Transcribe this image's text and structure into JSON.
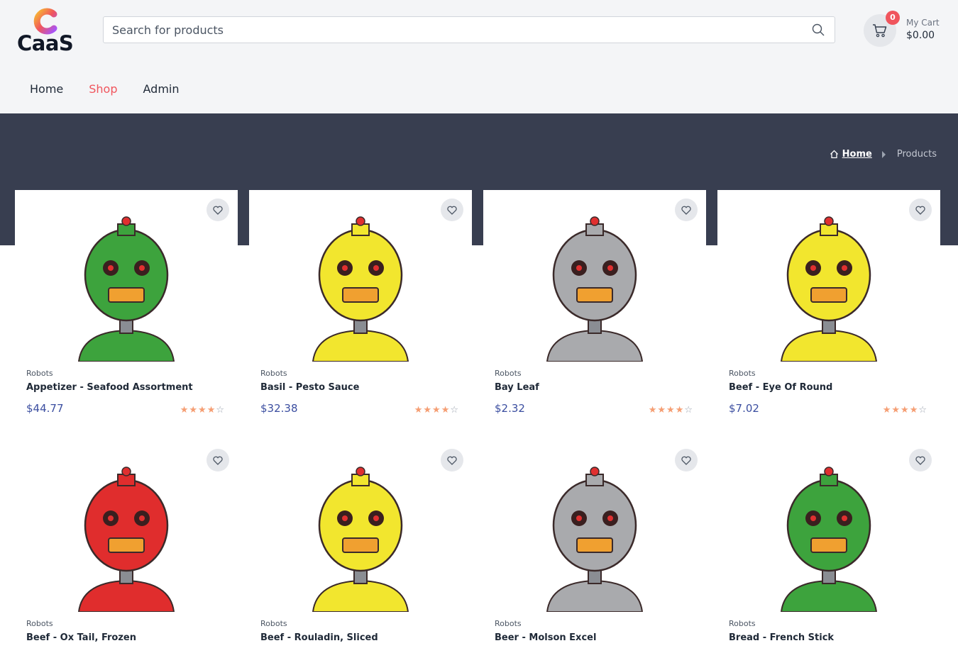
{
  "brand": {
    "name": "CaaS",
    "accent": "#f0555d"
  },
  "search": {
    "placeholder": "Search for products"
  },
  "cart": {
    "count": "0",
    "label": "My Cart",
    "total": "$0.00"
  },
  "nav": [
    {
      "label": "Home",
      "active": false
    },
    {
      "label": "Shop",
      "active": true
    },
    {
      "label": "Admin",
      "active": false
    }
  ],
  "breadcrumb": {
    "home": "Home",
    "current": "Products"
  },
  "products": [
    {
      "category": "Robots",
      "title": "Appetizer - Seafood Assortment",
      "price": "$44.77",
      "rating": 4,
      "color": "#3da33d"
    },
    {
      "category": "Robots",
      "title": "Basil - Pesto Sauce",
      "price": "$32.38",
      "rating": 4,
      "color": "#f2e62e"
    },
    {
      "category": "Robots",
      "title": "Bay Leaf",
      "price": "$2.32",
      "rating": 4,
      "color": "#a9aaad"
    },
    {
      "category": "Robots",
      "title": "Beef - Eye Of Round",
      "price": "$7.02",
      "rating": 4,
      "color": "#f2e62e"
    },
    {
      "category": "Robots",
      "title": "Beef - Ox Tail, Frozen",
      "price": "",
      "rating": 0,
      "color": "#e02d2d"
    },
    {
      "category": "Robots",
      "title": "Beef - Rouladin, Sliced",
      "price": "",
      "rating": 0,
      "color": "#f2e62e"
    },
    {
      "category": "Robots",
      "title": "Beer - Molson Excel",
      "price": "",
      "rating": 0,
      "color": "#a9aaad"
    },
    {
      "category": "Robots",
      "title": "Bread - French Stick",
      "price": "",
      "rating": 0,
      "color": "#3da33d"
    }
  ]
}
